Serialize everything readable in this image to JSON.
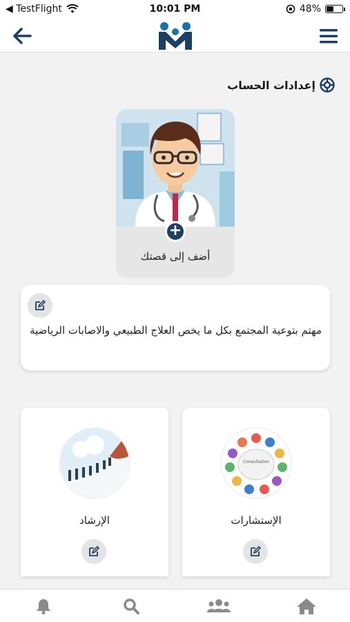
{
  "status_bar": {
    "back_app": "◀ TestFlight",
    "time": "10:01 PM",
    "battery": "48%",
    "battery_level": 0.48
  },
  "header": {
    "back_icon": "arrow-left-icon",
    "logo": "logo-icon",
    "menu_icon": "hamburger-menu-icon"
  },
  "section": {
    "title": "إعدادات الحساب",
    "icon": "settings-wheel-icon"
  },
  "story": {
    "add_label": "أضف إلى قصتك",
    "add_icon": "plus-icon"
  },
  "bio": {
    "text": "مهتم بتوعية المجتمع بكل ما يخص العلاج الطبيعي والاصابات الرياضية",
    "edit_icon": "edit-icon"
  },
  "services": [
    {
      "label": "الإستشارات",
      "icon": "edit-icon",
      "badge_text": "Consultation"
    },
    {
      "label": "الإرشاد",
      "icon": "edit-icon"
    }
  ],
  "bottom_nav": [
    {
      "icon": "bell-icon"
    },
    {
      "icon": "search-icon"
    },
    {
      "icon": "group-icon"
    },
    {
      "icon": "home-icon"
    }
  ],
  "colors": {
    "primary": "#1d3f63",
    "nav_icon": "#8a8a8a",
    "background": "#f2f2f2"
  }
}
